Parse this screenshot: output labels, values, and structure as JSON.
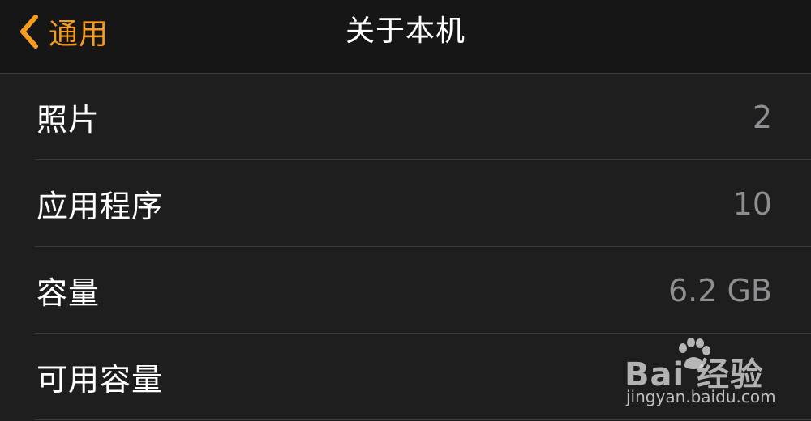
{
  "navbar": {
    "back_label": "通用",
    "title": "关于本机",
    "accent_color": "#f79c1c",
    "back_icon": "chevron-left-icon"
  },
  "rows": [
    {
      "label": "照片",
      "value": "2"
    },
    {
      "label": "应用程序",
      "value": "10"
    },
    {
      "label": "容量",
      "value": "6.2 GB"
    },
    {
      "label": "可用容量",
      "value": ""
    }
  ],
  "watermark": {
    "brand": "Bai  经验",
    "url": "jingyan.baidu.com"
  }
}
